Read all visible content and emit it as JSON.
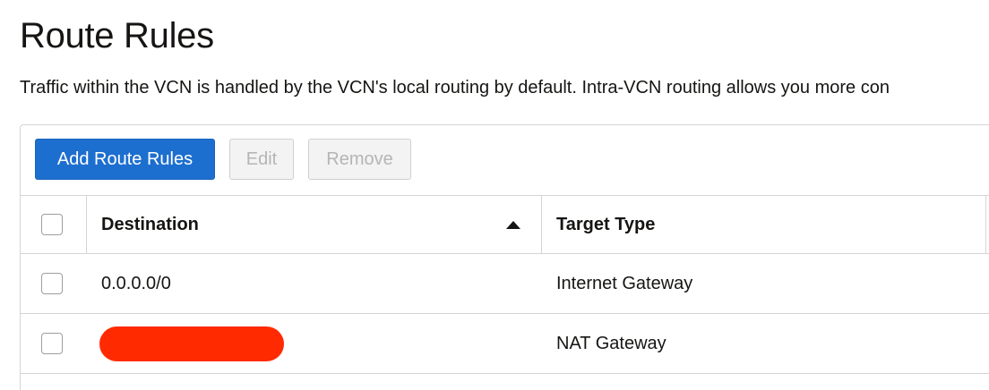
{
  "page": {
    "title": "Route Rules",
    "description": "Traffic within the VCN is handled by the VCN's local routing by default. Intra-VCN routing allows you more con"
  },
  "toolbar": {
    "add_label": "Add Route Rules",
    "edit_label": "Edit",
    "remove_label": "Remove",
    "edit_disabled": true,
    "remove_disabled": true
  },
  "table": {
    "columns": [
      "Destination",
      "Target Type"
    ],
    "sort": {
      "column": "Destination",
      "direction": "ascending"
    },
    "rows": [
      {
        "destination": "0.0.0.0/0",
        "target_type": "Internet Gateway",
        "selected": false,
        "destination_redacted": false
      },
      {
        "destination": "",
        "target_type": "NAT Gateway",
        "selected": false,
        "destination_redacted": true
      }
    ]
  },
  "colors": {
    "primary": "#1d6fcf",
    "redaction": "#ff2a00",
    "border": "#d4d4d4",
    "disabled_text": "#b5b5b5"
  }
}
